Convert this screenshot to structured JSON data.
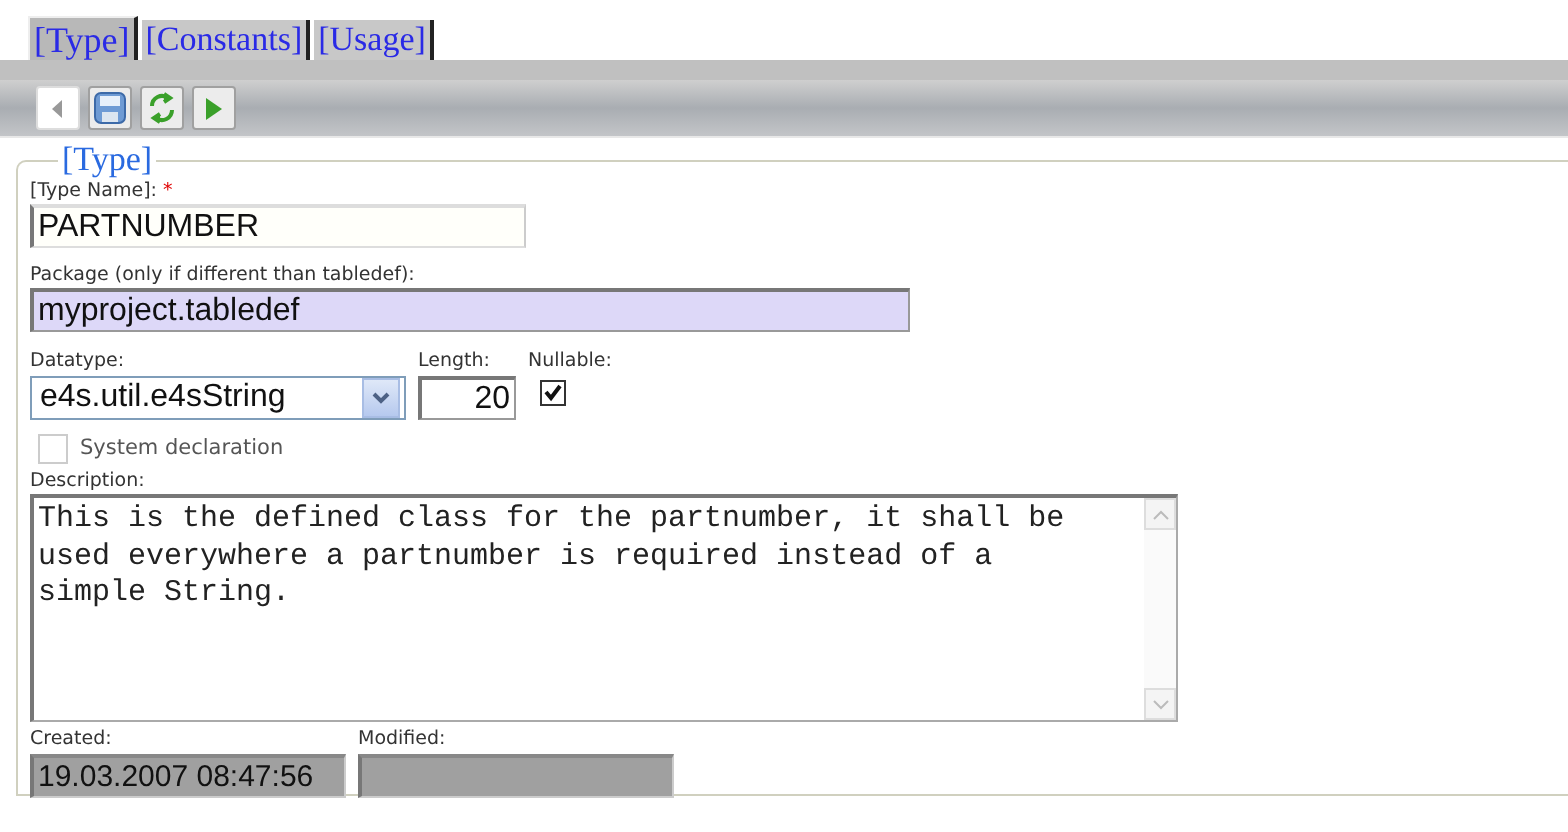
{
  "tabs": [
    {
      "label": "[Type]",
      "selected": true
    },
    {
      "label": "[Constants]",
      "selected": false
    },
    {
      "label": "[Usage]",
      "selected": false
    }
  ],
  "toolbar": [
    {
      "kind": "back",
      "disabled": true
    },
    {
      "kind": "save",
      "disabled": false
    },
    {
      "kind": "refresh",
      "disabled": false
    },
    {
      "kind": "run",
      "disabled": false
    }
  ],
  "group": {
    "legend": "[Type]",
    "type_name": {
      "label": "[Type Name]:",
      "required_mark": "*",
      "value": "PARTNUMBER"
    },
    "package": {
      "label": "Package (only if different than tabledef):",
      "value": "myproject.tabledef"
    },
    "datatype": {
      "label": "Datatype:",
      "value": "e4s.util.e4sString"
    },
    "length": {
      "label": "Length:",
      "value": "20"
    },
    "nullable": {
      "label": "Nullable:",
      "checked": true
    },
    "system_declaration": {
      "label": "System declaration",
      "checked": false,
      "disabled": true
    },
    "description": {
      "label": "Description:",
      "value": "This is the defined class for the partnumber, it shall be used everywhere a partnumber is required instead of a simple String."
    },
    "created": {
      "label": "Created:",
      "value": "19.03.2007 08:47:56"
    },
    "modified": {
      "label": "Modified:"
    }
  }
}
